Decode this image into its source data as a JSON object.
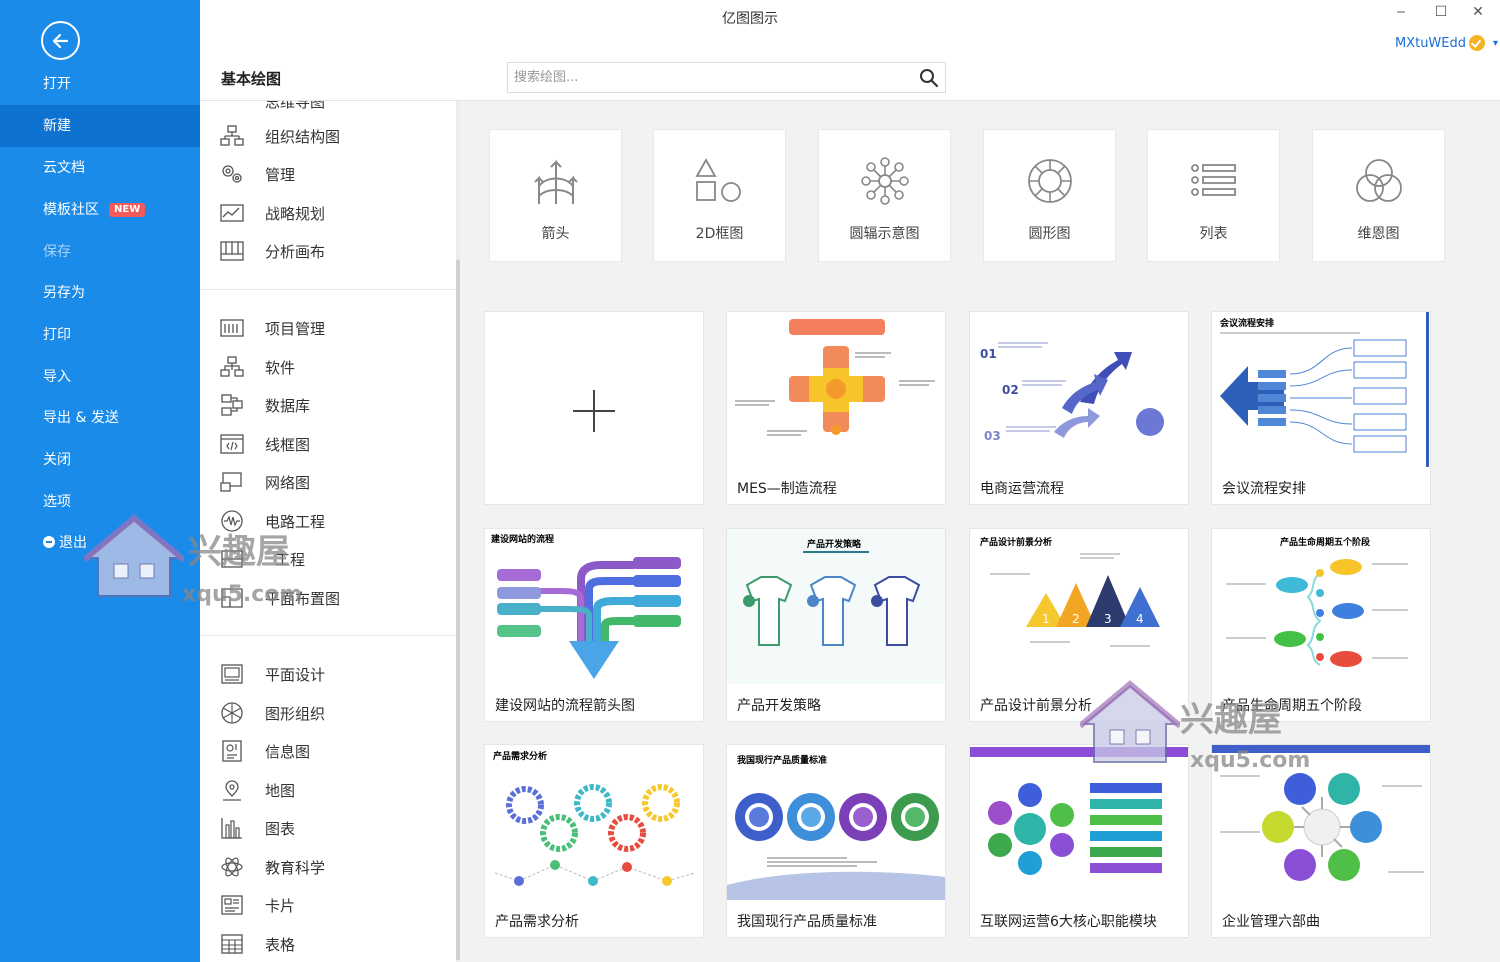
{
  "window": {
    "title": "亿图图示",
    "minimize": "‒",
    "maximize": "☐",
    "close": "✕"
  },
  "user": {
    "name": "MXtuWEdd",
    "caret": "▾"
  },
  "nav": {
    "items": [
      {
        "label": "打开"
      },
      {
        "label": "新建"
      },
      {
        "label": "云文档"
      },
      {
        "label": "模板社区",
        "badge": "NEW"
      },
      {
        "label": "保存"
      },
      {
        "label": "另存为"
      },
      {
        "label": "打印"
      },
      {
        "label": "导入"
      },
      {
        "label": "导出 & 发送"
      },
      {
        "label": "关闭"
      },
      {
        "label": "选项"
      },
      {
        "label": "退出"
      }
    ]
  },
  "section_title": "基本绘图",
  "search": {
    "placeholder": "搜索绘图..."
  },
  "categories": {
    "group1": [
      {
        "label": "思维导图",
        "icon": "mindmap-icon"
      },
      {
        "label": "组织结构图",
        "icon": "org-chart-icon"
      },
      {
        "label": "管理",
        "icon": "gears-icon"
      },
      {
        "label": "战略规划",
        "icon": "strategy-icon"
      },
      {
        "label": "分析画布",
        "icon": "canvas-icon"
      }
    ],
    "group2": [
      {
        "label": "项目管理",
        "icon": "project-icon"
      },
      {
        "label": "软件",
        "icon": "software-icon"
      },
      {
        "label": "数据库",
        "icon": "database-icon"
      },
      {
        "label": "线框图",
        "icon": "wireframe-icon"
      },
      {
        "label": "网络图",
        "icon": "network-icon"
      },
      {
        "label": "电路工程",
        "icon": "circuit-icon"
      },
      {
        "label": "工程",
        "icon": "engineering-icon"
      },
      {
        "label": "平面布置图",
        "icon": "floorplan-icon"
      }
    ],
    "group3": [
      {
        "label": "平面设计",
        "icon": "graphic-design-icon"
      },
      {
        "label": "图形组织",
        "icon": "graphic-organizer-icon"
      },
      {
        "label": "信息图",
        "icon": "infographic-icon"
      },
      {
        "label": "地图",
        "icon": "map-pin-icon"
      },
      {
        "label": "图表",
        "icon": "chart-icon"
      },
      {
        "label": "教育科学",
        "icon": "atom-icon"
      },
      {
        "label": "卡片",
        "icon": "card-icon"
      },
      {
        "label": "表格",
        "icon": "table-icon"
      }
    ]
  },
  "diagram_types": [
    {
      "label": "箭头",
      "icon": "arrows-icon"
    },
    {
      "label": "2D框图",
      "icon": "shapes-2d-icon"
    },
    {
      "label": "圆辐示意图",
      "icon": "radial-icon"
    },
    {
      "label": "圆形图",
      "icon": "circular-icon"
    },
    {
      "label": "列表",
      "icon": "list-icon"
    },
    {
      "label": "维恩图",
      "icon": "venn-icon"
    }
  ],
  "templates": [
    {
      "label": ""
    },
    {
      "label": "MES—制造流程",
      "thumb_title": ""
    },
    {
      "label": "电商运营流程",
      "thumb_title": ""
    },
    {
      "label": "会议流程安排",
      "thumb_title": "会议流程安排"
    },
    {
      "label": "建设网站的流程箭头图",
      "thumb_title": "建设网站的流程"
    },
    {
      "label": "产品开发策略",
      "thumb_title": "产品开发策略"
    },
    {
      "label": "产品设计前景分析",
      "thumb_title": "产品设计前景分析"
    },
    {
      "label": "产品生命周期五个阶段",
      "thumb_title": "产品生命周期五个阶段"
    },
    {
      "label": "产品需求分析",
      "thumb_title": "产品需求分析"
    },
    {
      "label": "我国现行产品质量标准",
      "thumb_title": "我国现行产品质量标准"
    },
    {
      "label": "互联网运营6大核心职能模块",
      "thumb_title": ""
    },
    {
      "label": "企业管理六部曲",
      "thumb_title": ""
    }
  ],
  "watermark": {
    "text": "兴趣屋",
    "url": "xqu5.com"
  },
  "colors": {
    "nav_bg": "#1a8be9",
    "nav_active": "#0d72d0",
    "badge": "#f35b5b",
    "user_link": "#1a6ed8"
  }
}
